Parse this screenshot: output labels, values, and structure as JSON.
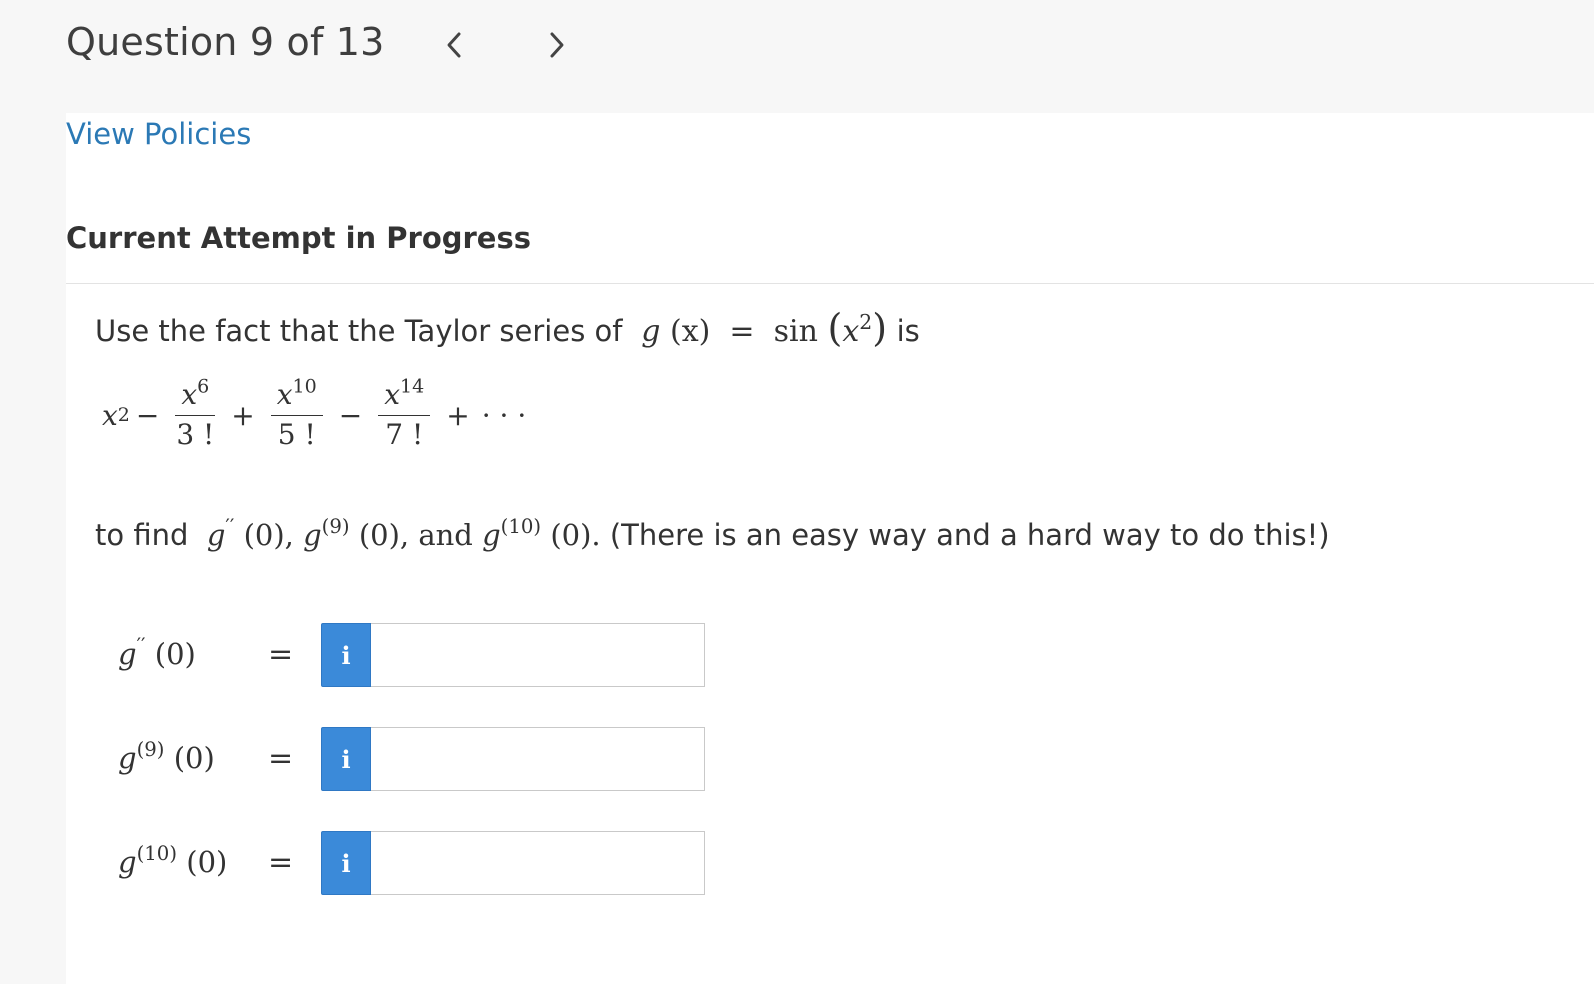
{
  "header": {
    "question_label": "Question 9 of 13",
    "prev_icon": "chevron-left-icon",
    "next_icon": "chevron-right-icon"
  },
  "links": {
    "view_policies": "View Policies"
  },
  "attempt_heading": "Current Attempt in Progress",
  "problem": {
    "prompt_prefix": "Use the fact that the Taylor series of",
    "func_g": "g",
    "func_arg": "(x)",
    "equals": "=",
    "func_sin": "sin",
    "func_inner_base": "x",
    "func_inner_exp": "2",
    "prompt_suffix": "is",
    "series": {
      "t1_base": "x",
      "t1_exp": "2",
      "minus1": "−",
      "f1_num_base": "x",
      "f1_num_exp": "6",
      "f1_den": "3 !",
      "plus1": "+",
      "f2_num_base": "x",
      "f2_num_exp": "10",
      "f2_den": "5 !",
      "minus2": "−",
      "f3_num_base": "x",
      "f3_num_exp": "14",
      "f3_den": "7 !",
      "plus2": "+",
      "ellipsis": "· · ·"
    },
    "find": {
      "prefix": "to find",
      "g": "g",
      "d2_sup": "′′",
      "zero": "(0),",
      "d9_sup": "(9)",
      "zero2": "(0), and",
      "d10_sup": "(10)",
      "zero3": "(0).",
      "suffix": "(There is an easy way and a hard way to do this!)"
    }
  },
  "answers": [
    {
      "g": "g",
      "sup": "′′",
      "arg": "(0)",
      "eq": "=",
      "value": "",
      "info_label": "i"
    },
    {
      "g": "g",
      "sup": "(9)",
      "arg": "(0)",
      "eq": "=",
      "value": "",
      "info_label": "i"
    },
    {
      "g": "g",
      "sup": "(10)",
      "arg": "(0)",
      "eq": "=",
      "value": "",
      "info_label": "i"
    }
  ]
}
